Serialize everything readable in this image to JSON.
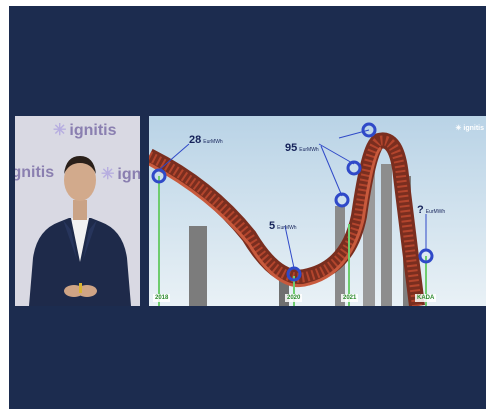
{
  "left_panel": {
    "logo_text": "ignitis"
  },
  "chart_panel": {
    "corner_logo": "ignitis",
    "unit": "EurMWh",
    "labels": [
      {
        "value": "28",
        "year": "2018"
      },
      {
        "value": "5",
        "year": "2020"
      },
      {
        "value": "95",
        "year": "2021"
      },
      {
        "value": "?",
        "year": "KADA"
      }
    ]
  },
  "colors": {
    "background": "#1c2c4f",
    "track": "#b3452d",
    "marker": "#2f49c8",
    "year_text": "#2c8a2c",
    "value_text": "#16235a"
  }
}
